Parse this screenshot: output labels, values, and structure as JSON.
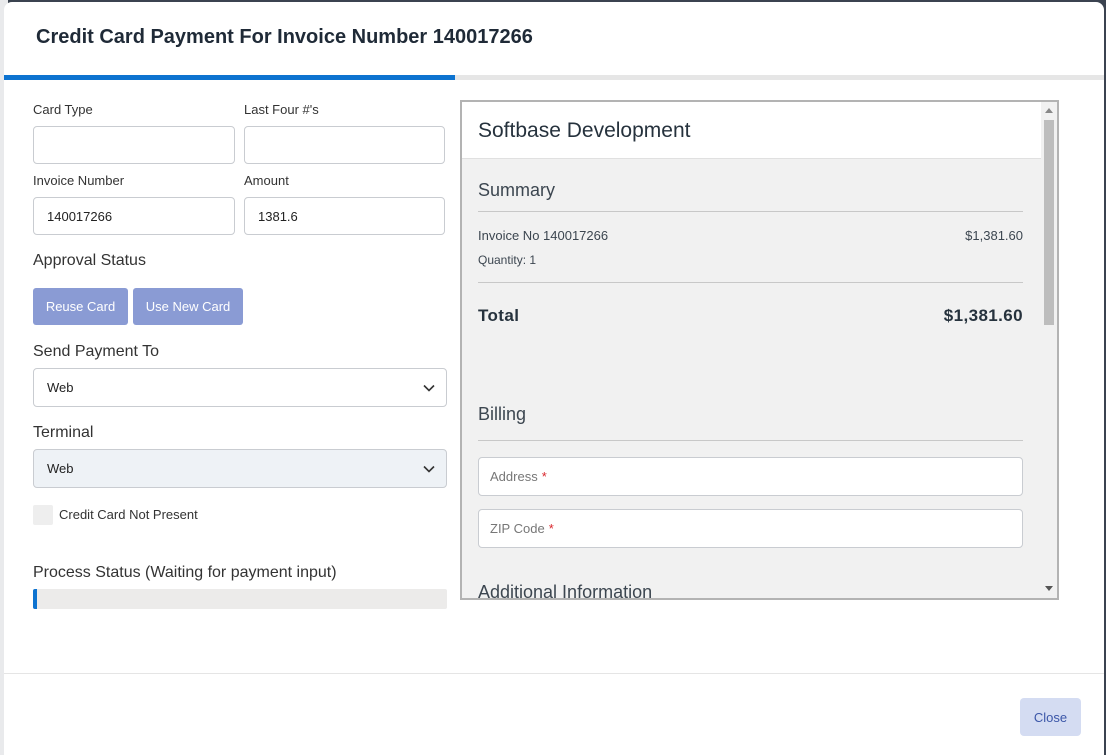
{
  "modal": {
    "title": "Credit Card Payment For Invoice Number 140017266",
    "progress": 0.41
  },
  "form": {
    "card_type_label": "Card Type",
    "card_type_value": "",
    "last_four_label": "Last Four #'s",
    "last_four_value": "",
    "invoice_number_label": "Invoice Number",
    "invoice_number_value": "140017266",
    "amount_label": "Amount",
    "amount_value": "1381.6",
    "approval_status_label": "Approval Status",
    "reuse_card_label": "Reuse Card",
    "use_new_card_label": "Use New Card",
    "send_payment_label": "Send Payment To",
    "send_payment_value": "Web",
    "terminal_label": "Terminal",
    "terminal_value": "Web",
    "card_not_present_label": "Credit Card Not Present",
    "card_not_present_checked": false,
    "process_status_label": "Process Status (Waiting for payment input)",
    "process_progress": 0.01
  },
  "payment_frame": {
    "merchant": "Softbase Development",
    "summary_title": "Summary",
    "line_item": "Invoice No 140017266",
    "line_amount": "$1,381.60",
    "quantity": "Quantity: 1",
    "total_label": "Total",
    "total_amount": "$1,381.60",
    "billing_title": "Billing",
    "address_placeholder": "Address",
    "zip_placeholder": "ZIP Code",
    "required_mark": "*",
    "additional_title": "Additional Information"
  },
  "footer": {
    "close_label": "Close"
  },
  "colors": {
    "accent": "#0d73d0",
    "action_button": "#8a9bd4",
    "close_button_bg": "#d4dcf2",
    "required": "#d9262c"
  },
  "icons": {
    "select_chevron": "chevron-down-icon"
  }
}
